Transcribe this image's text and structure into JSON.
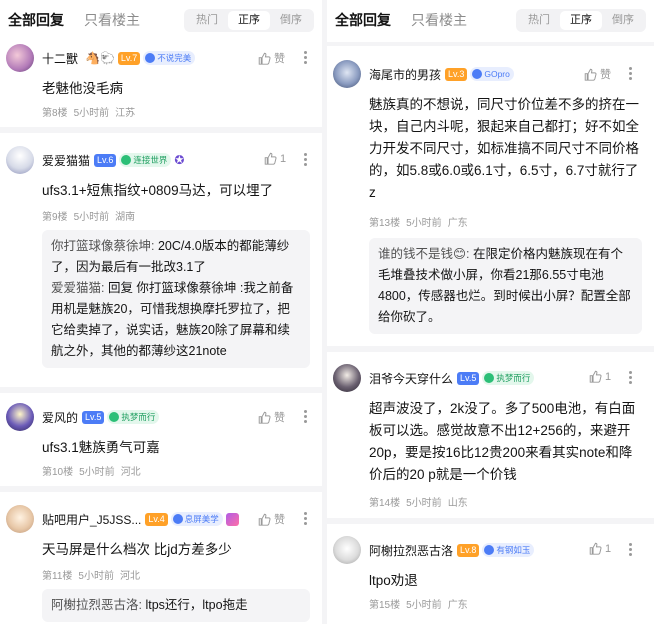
{
  "left": {
    "tabs": {
      "all": "全部回复",
      "lz": "只看楼主"
    },
    "sort": [
      "热门",
      "正序",
      "倒序"
    ],
    "posts": [
      {
        "name": "十二獸",
        "extra": "🐴🐑",
        "level": "Lv.7",
        "level_color": "#ffa128",
        "medal": "不说完美",
        "medal_color": "#4c7cf6",
        "like": "赞",
        "text": "老魅他没毛病",
        "floor": "第8楼",
        "time": "5小时前",
        "place": "江苏"
      },
      {
        "name": "爱爱猫猫",
        "extra": "",
        "level": "Lv.6",
        "level_color": "#4c7cf6",
        "medal": "连接世界",
        "medal_color": "#2cbf77",
        "like": "1",
        "text": "ufs3.1+短焦指纹+0809马达，可以埋了",
        "floor": "第9楼",
        "time": "5小时前",
        "place": "湖南",
        "quote": {
          "name1": "你打篮球像蔡徐坤:",
          "text1": " 20C/4.0版本的都能薄纱了，因为最后有一批改3.1了",
          "name2": "爱爱猫猫:",
          "text2": " 回复 你打篮球像蔡徐坤 :我之前备用机是魅族20，可惜我想换摩托罗拉了，把它给卖掉了，说实话，魅族20除了屏幕和续航之外，其他的都薄纱这21note"
        }
      },
      {
        "name": "爱风的",
        "extra": "",
        "level": "Lv.5",
        "level_color": "#4c7cf6",
        "medal": "执梦而行",
        "medal_color": "#2cbf77",
        "like": "赞",
        "text": "ufs3.1魅族勇气可嘉",
        "floor": "第10楼",
        "time": "5小时前",
        "place": "河北"
      },
      {
        "name": "贴吧用户_J5JSS...",
        "extra": "",
        "level": "Lv.4",
        "level_color": "#ffa128",
        "medal": "息屏美学",
        "medal_color": "#4c7cf6",
        "like": "赞",
        "text": "天马屏是什么档次 比jd方差多少",
        "floor": "第11楼",
        "time": "5小时前",
        "place": "河北",
        "quote": {
          "name1": "阿榭拉烈恶古洛:",
          "text1": " ltps还行，ltpo拖走"
        }
      }
    ]
  },
  "right": {
    "tabs": {
      "all": "全部回复",
      "lz": "只看楼主"
    },
    "sort": [
      "热门",
      "正序",
      "倒序"
    ],
    "posts": [
      {
        "name": "海尾市的男孩",
        "extra": "",
        "level": "Lv.3",
        "level_color": "#ffa128",
        "medal": "GOpro",
        "medal_color": "#4c7cf6",
        "like": "赞",
        "text": "魅族真的不想说，同尺寸价位差不多的挤在一块，自己内斗呢，狠起来自己都打；好不如全力开发不同尺寸，如标准搞不同尺寸不同价格的，如5.8或6.0或6.1寸，6.5寸，6.7寸就行了z",
        "floor": "第13楼",
        "time": "5小时前",
        "place": "广东",
        "quote": {
          "name1": "谁的钱不是钱😊:",
          "text1": " 在限定价格内魅族现在有个毛堆叠技术做小屏，你看21那6.55寸电池4800，传感器也烂。到时候出小屏？配置全部给你砍了。"
        }
      },
      {
        "name": "泪爷今天穿什么",
        "extra": "",
        "level": "Lv.5",
        "level_color": "#4c7cf6",
        "medal": "执梦而行",
        "medal_color": "#2cbf77",
        "like": "1",
        "text": "超声波没了，2k没了。多了500电池，有白面板可以选。感觉故意不出12+256的，来避开20p，要是按16比12贵200来看其实note和降价后的20 p就是一个价钱",
        "floor": "第14楼",
        "time": "5小时前",
        "place": "山东"
      },
      {
        "name": "阿榭拉烈恶古洛",
        "extra": "",
        "level": "Lv.8",
        "level_color": "#ffa128",
        "medal": "有钢如玉",
        "medal_color": "#4c7cf6",
        "like": "1",
        "text": "ltpo劝退",
        "floor": "第15楼",
        "time": "5小时前",
        "place": "广东"
      }
    ]
  }
}
